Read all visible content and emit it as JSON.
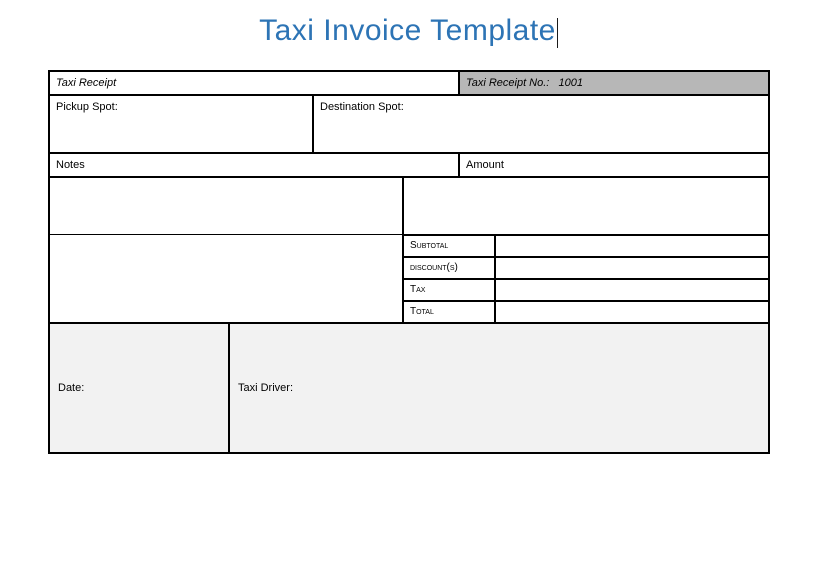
{
  "title": "Taxi Invoice Template",
  "header": {
    "receipt_label": "Taxi Receipt",
    "receipt_no_label": "Taxi Receipt No.:",
    "receipt_no_value": "1001"
  },
  "spots": {
    "pickup_label": "Pickup Spot:",
    "destination_label": "Destination Spot:"
  },
  "body": {
    "notes_label": "Notes",
    "amount_label": "Amount"
  },
  "totals": {
    "subtotal": "Subtotal",
    "discounts": "discount(s)",
    "tax": "Tax",
    "total": "Total"
  },
  "footer": {
    "date_label": "Date:",
    "driver_label": "Taxi Driver:"
  }
}
